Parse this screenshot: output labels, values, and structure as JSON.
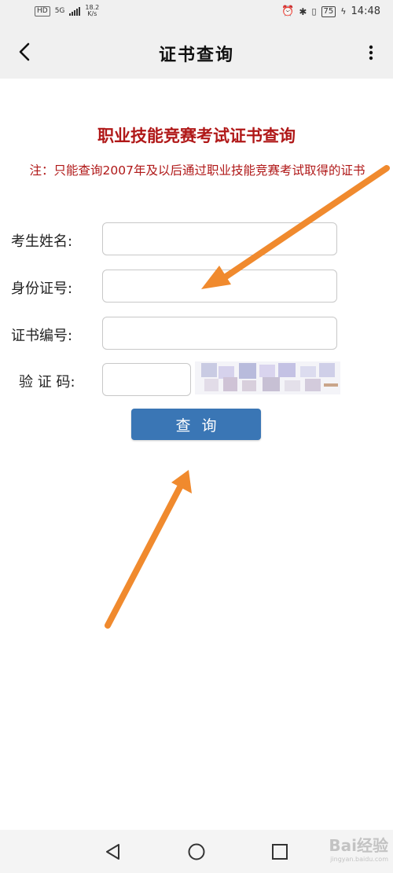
{
  "status_bar": {
    "hd": "HD",
    "network": "5G",
    "net_speed_value": "18.2",
    "net_speed_unit": "K/s",
    "battery": "75",
    "time": "14:48"
  },
  "app_bar": {
    "title": "证书查询",
    "back_icon": "chevron-left-icon",
    "menu_icon": "more-vertical-icon"
  },
  "page": {
    "heading": "职业技能竞赛考试证书查询",
    "note": "注：只能查询2007年及以后通过职业技能竞赛考试取得的证书",
    "accent_color": "#b01818",
    "button_color": "#3a76b5"
  },
  "form": {
    "fields": [
      {
        "label": "考生姓名:",
        "value": ""
      },
      {
        "label": "身份证号:",
        "value": ""
      },
      {
        "label": "证书编号:",
        "value": ""
      },
      {
        "label": "验 证 码:",
        "value": ""
      }
    ],
    "submit_label": "查询"
  },
  "annotations": {
    "arrow_color": "#f08a2e",
    "count": 2
  },
  "nav_bar": {
    "back_icon": "triangle-back-icon",
    "home_icon": "circle-home-icon",
    "recents_icon": "square-recents-icon"
  },
  "watermark": {
    "text": "Bai经验",
    "subtext": "jingyan.baidu.com"
  }
}
